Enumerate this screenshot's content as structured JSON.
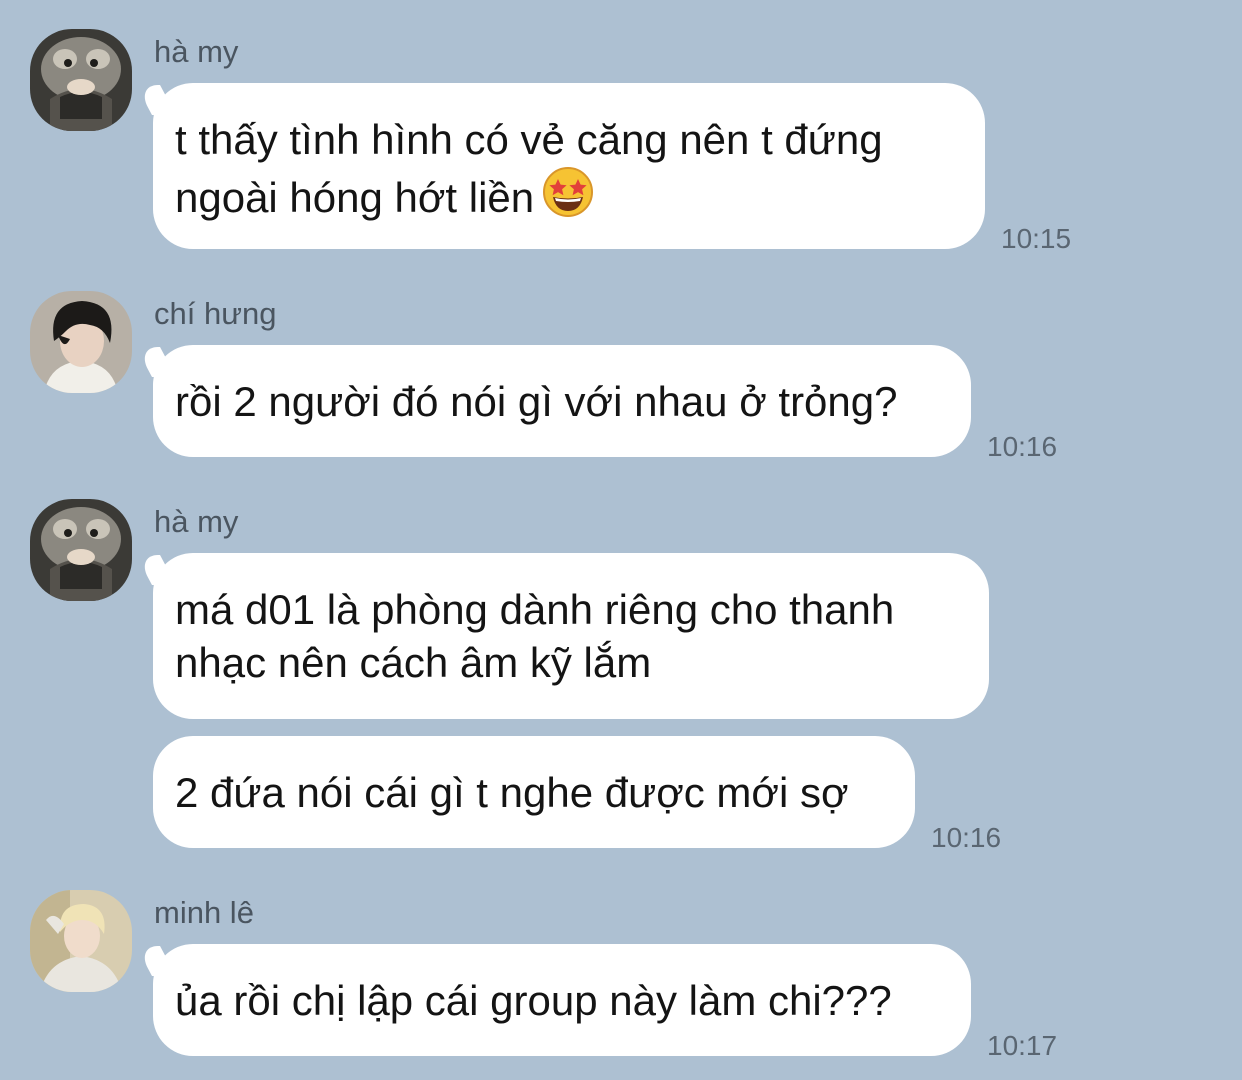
{
  "messages": [
    {
      "sender": "hà my",
      "avatar_icon": "cat-avatar-icon",
      "bubbles": [
        {
          "lines": [
            "t thấy tình hình có vẻ căng nên t đứng",
            "ngoài hóng hớt liền"
          ],
          "emoji": "star-struck-emoji-icon"
        }
      ],
      "time": "10:15"
    },
    {
      "sender": "chí hưng",
      "avatar_icon": "person-avatar-icon",
      "bubbles": [
        {
          "lines": [
            "rồi 2 người đó nói gì với nhau ở trỏng?"
          ]
        }
      ],
      "time": "10:16"
    },
    {
      "sender": "hà my",
      "avatar_icon": "cat-avatar-icon",
      "bubbles": [
        {
          "lines": [
            "má d01 là phòng dành riêng cho thanh",
            "nhạc nên cách âm kỹ lắm"
          ]
        },
        {
          "lines": [
            "2 đứa nói cái gì t nghe được mới sợ"
          ]
        }
      ],
      "time": "10:16"
    },
    {
      "sender": "minh lê",
      "avatar_icon": "person-avatar-icon",
      "bubbles": [
        {
          "lines": [
            "ủa rồi chị lập cái group này làm chi???"
          ]
        }
      ],
      "time": "10:17"
    }
  ],
  "colors": {
    "background": "#adc0d2",
    "bubble": "#ffffff",
    "text": "#141414",
    "meta": "#5a6672"
  }
}
